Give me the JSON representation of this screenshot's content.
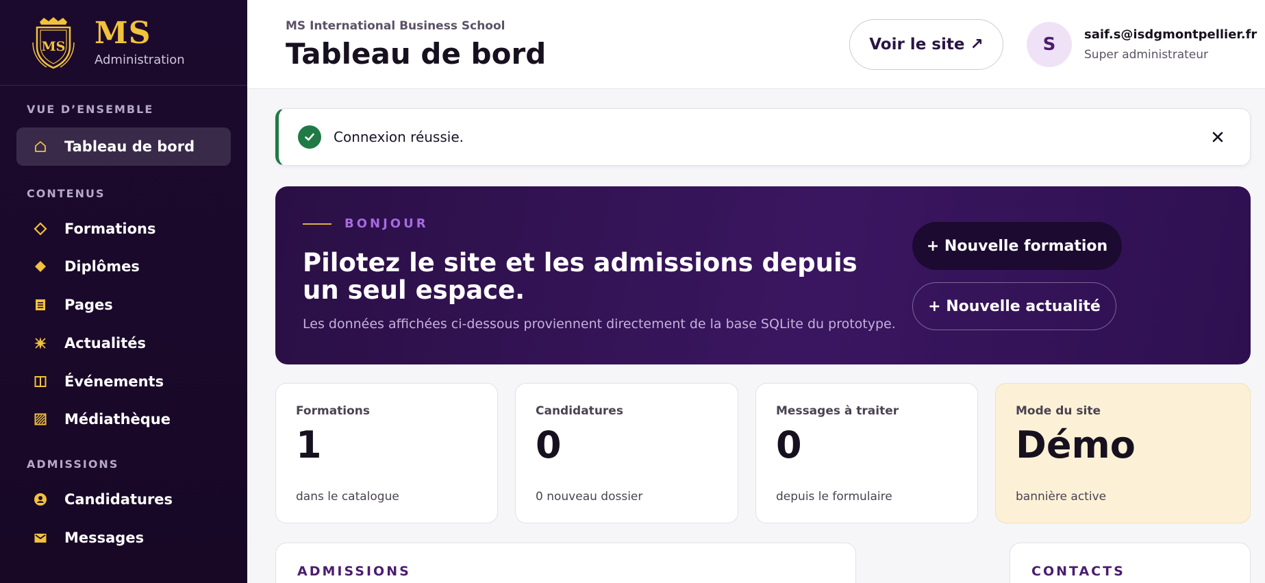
{
  "brand": {
    "mark": "MS",
    "subtitle": "Administration",
    "crest_letters": "MS"
  },
  "sidebar": {
    "sections": [
      {
        "label": "VUE D’ENSEMBLE"
      },
      {
        "label": "CONTENUS"
      },
      {
        "label": "ADMISSIONS"
      }
    ],
    "items": [
      {
        "label": "Tableau de bord",
        "icon": "home-icon",
        "active": true
      },
      {
        "label": "Formations",
        "icon": "diamond-outline-icon"
      },
      {
        "label": "Diplômes",
        "icon": "diamond-filled-icon"
      },
      {
        "label": "Pages",
        "icon": "document-icon"
      },
      {
        "label": "Actualités",
        "icon": "sparkle-icon"
      },
      {
        "label": "Événements",
        "icon": "calendar-columns-icon"
      },
      {
        "label": "Médiathèque",
        "icon": "media-icon"
      },
      {
        "label": "Candidatures",
        "icon": "user-circle-icon"
      },
      {
        "label": "Messages",
        "icon": "envelope-icon"
      }
    ]
  },
  "header": {
    "school": "MS International Business School",
    "title": "Tableau de bord",
    "view_site": "Voir le site ↗",
    "user": {
      "initial": "S",
      "email": "saif.s@isdgmontpellier.fr",
      "role": "Super administrateur"
    }
  },
  "alert": {
    "message": "Connexion réussie.",
    "icon": "check-circle-icon"
  },
  "hero": {
    "eyebrow": "BONJOUR",
    "headline": "Pilotez le site et les admissions depuis un seul espace.",
    "subtitle": "Les données affichées ci-dessous proviennent directement de la base SQLite du prototype.",
    "primary_button": "+ Nouvelle formation",
    "secondary_button": "+ Nouvelle actualité"
  },
  "stats": [
    {
      "label": "Formations",
      "value": "1",
      "note": "dans le catalogue"
    },
    {
      "label": "Candidatures",
      "value": "0",
      "note": "0 nouveau dossier"
    },
    {
      "label": "Messages à traiter",
      "value": "0",
      "note": "depuis le formulaire"
    },
    {
      "label": "Mode du site",
      "value": "Démo",
      "note": "bannière active"
    }
  ],
  "panels": [
    {
      "title": "ADMISSIONS"
    },
    {
      "title": "CONTACTS"
    }
  ],
  "colors": {
    "sidebar_bg": "#1c0a2e",
    "accent_gold": "#f2c23a",
    "hero_bg": "#2a0f45",
    "success": "#1f7a45",
    "demo_card": "#fcf1d6"
  }
}
